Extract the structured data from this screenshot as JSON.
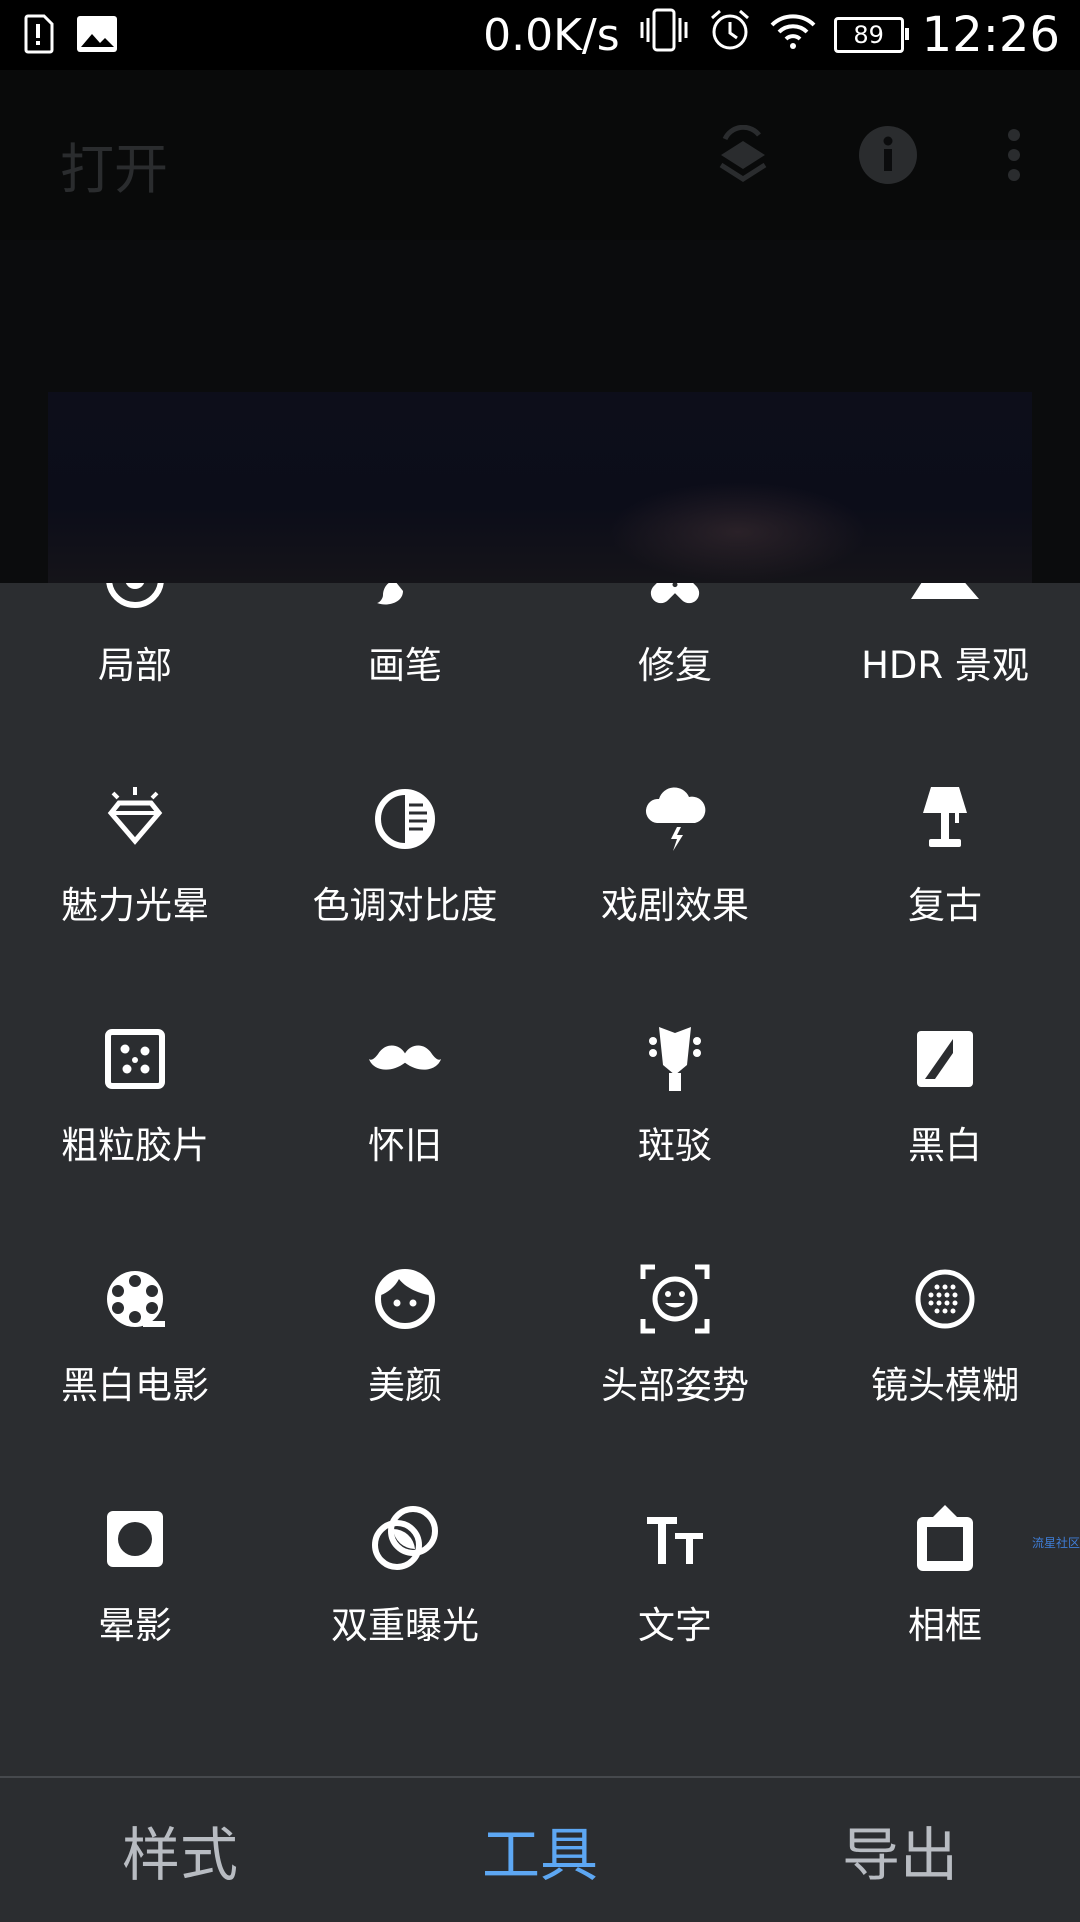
{
  "status_bar": {
    "net_speed": "0.0K/s",
    "battery": "89",
    "time": "12:26"
  },
  "app_bar": {
    "title": "打开"
  },
  "tools": [
    {
      "label": "局部",
      "icon": "target-icon"
    },
    {
      "label": "画笔",
      "icon": "brush-icon"
    },
    {
      "label": "修复",
      "icon": "bandage-icon"
    },
    {
      "label": "HDR 景观",
      "icon": "mountain-icon"
    },
    {
      "label": "魅力光晕",
      "icon": "diamond-icon"
    },
    {
      "label": "色调对比度",
      "icon": "tonal-contrast-icon"
    },
    {
      "label": "戏剧效果",
      "icon": "storm-cloud-icon"
    },
    {
      "label": "复古",
      "icon": "lamp-icon"
    },
    {
      "label": "粗粒胶片",
      "icon": "grain-icon"
    },
    {
      "label": "怀旧",
      "icon": "mustache-icon"
    },
    {
      "label": "斑驳",
      "icon": "guitar-head-icon"
    },
    {
      "label": "黑白",
      "icon": "black-white-icon"
    },
    {
      "label": "黑白电影",
      "icon": "film-reel-icon"
    },
    {
      "label": "美颜",
      "icon": "face-icon"
    },
    {
      "label": "头部姿势",
      "icon": "face-scan-icon"
    },
    {
      "label": "镜头模糊",
      "icon": "lens-blur-icon"
    },
    {
      "label": "晕影",
      "icon": "vignette-icon"
    },
    {
      "label": "双重曝光",
      "icon": "double-exposure-icon"
    },
    {
      "label": "文字",
      "icon": "text-icon"
    },
    {
      "label": "相框",
      "icon": "frame-icon"
    }
  ],
  "watermark": "流星社区",
  "bottom_nav": {
    "tabs": [
      {
        "label": "样式",
        "active": false
      },
      {
        "label": "工具",
        "active": true
      },
      {
        "label": "导出",
        "active": false
      }
    ],
    "active_color": "#5da7f3"
  }
}
